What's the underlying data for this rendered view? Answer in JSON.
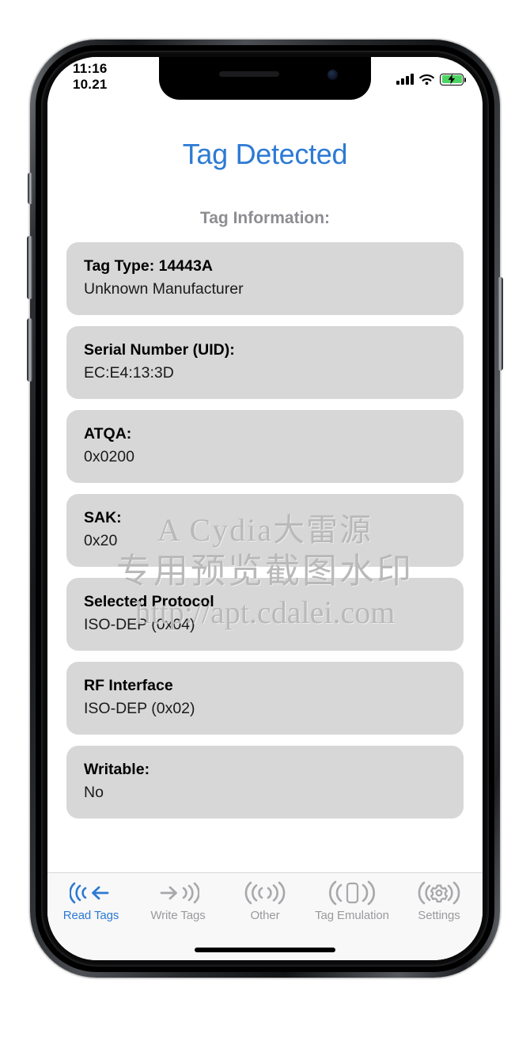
{
  "status_bar": {
    "time": "11:16",
    "date": "10.21",
    "signal_icon": "cellular-signal-icon",
    "wifi_icon": "wifi-icon",
    "battery_icon": "battery-charging-icon",
    "battery_color": "#4cd562"
  },
  "header": {
    "title": "Tag Detected",
    "title_color": "#2d7ad4",
    "section_label": "Tag Information:"
  },
  "cards": [
    {
      "title": "Tag Type: 14443A",
      "value": "Unknown Manufacturer"
    },
    {
      "title": "Serial Number (UID):",
      "value": "EC:E4:13:3D"
    },
    {
      "title": "ATQA:",
      "value": "0x0200"
    },
    {
      "title": "SAK:",
      "value": "0x20"
    },
    {
      "title": "Selected Protocol",
      "value": "ISO-DEP (0x04)"
    },
    {
      "title": "RF Interface",
      "value": "ISO-DEP (0x02)"
    },
    {
      "title": "Writable:",
      "value": "No"
    }
  ],
  "watermark": {
    "line1": "A Cydia大雷源",
    "line2": "专用预览截图水印",
    "line3": "http://apt.cdalei.com",
    "color": "#b9b9b9"
  },
  "tabbar": {
    "active_color": "#2d7ad4",
    "inactive_color": "#9a9a9e",
    "items": [
      {
        "label": "Read Tags",
        "icon": "nfc-read-icon",
        "active": true
      },
      {
        "label": "Write Tags",
        "icon": "nfc-write-icon",
        "active": false
      },
      {
        "label": "Other",
        "icon": "nfc-waves-icon",
        "active": false
      },
      {
        "label": "Tag Emulation",
        "icon": "nfc-phone-icon",
        "active": false
      },
      {
        "label": "Settings",
        "icon": "nfc-gear-icon",
        "active": false
      }
    ]
  },
  "card_background": "#d7d7d7"
}
